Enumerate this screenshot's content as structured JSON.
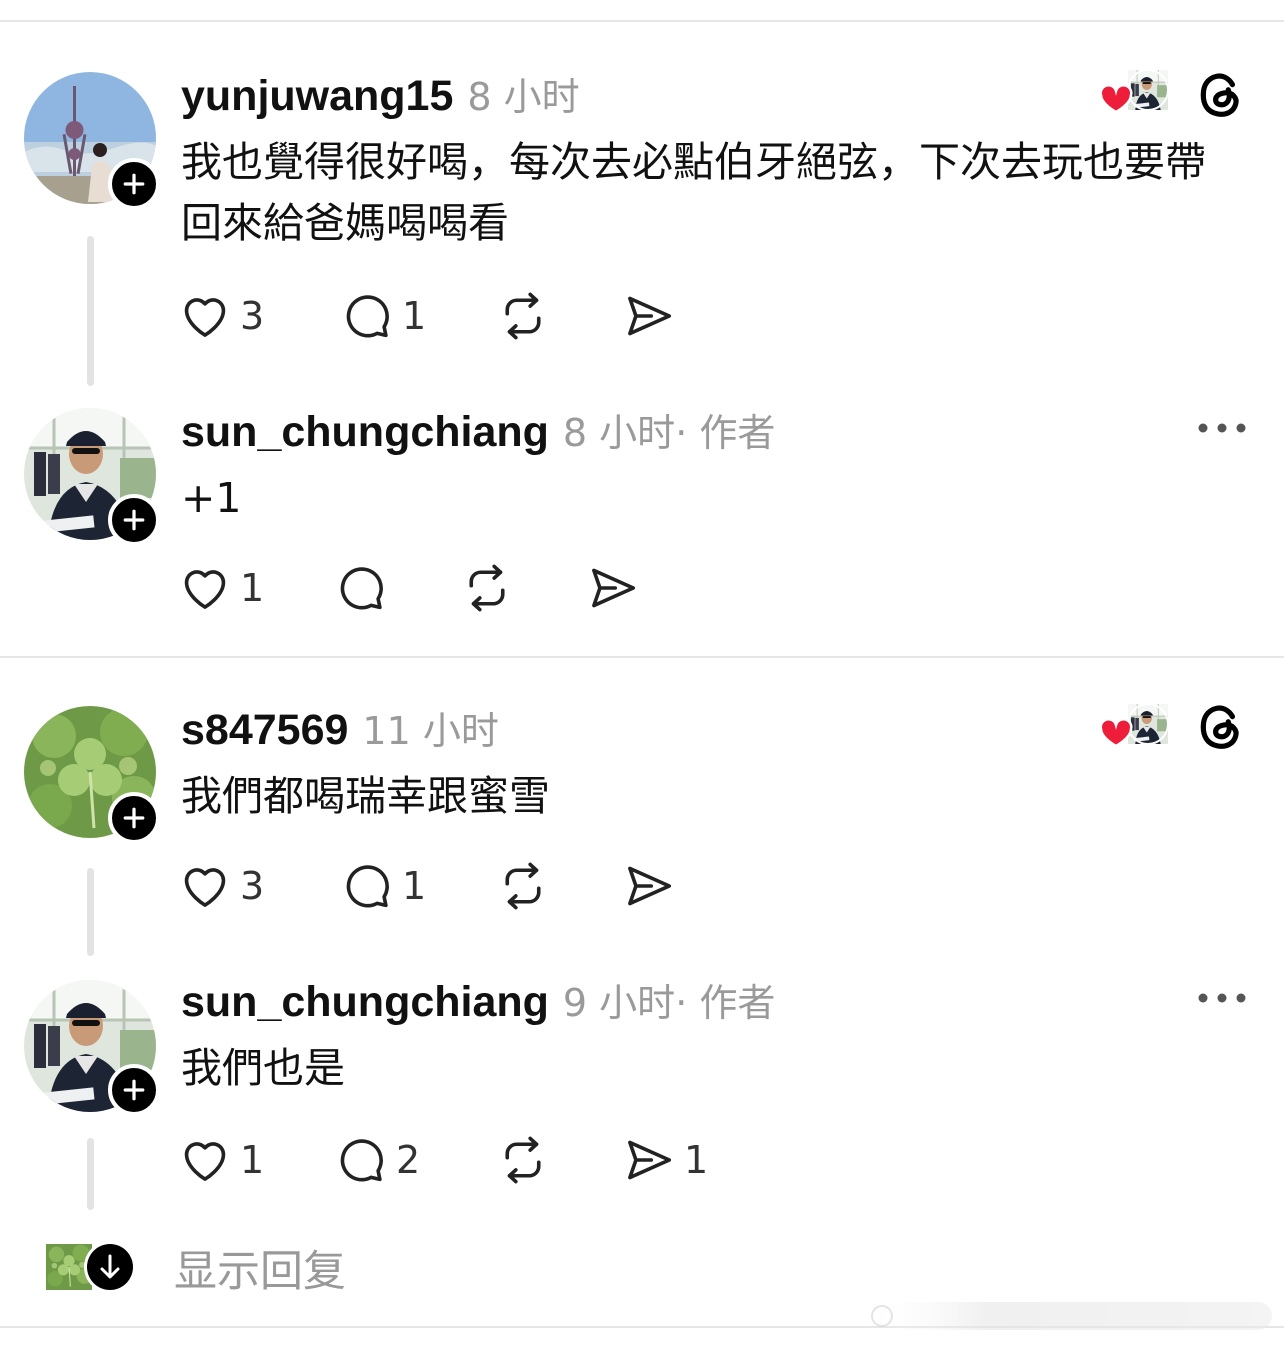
{
  "comments": [
    {
      "username": "yunjuwang15",
      "time": "8 小时",
      "author_tag": "",
      "text": "我也覺得很好喝，每次去必點伯牙絕弦，下次去玩也要帶回來給爸媽喝喝看",
      "likes": "3",
      "replies": "1",
      "reposts": "",
      "shares": ""
    },
    {
      "username": "sun_chungchiang",
      "time": "8 小时",
      "author_tag": " · 作者",
      "text": "+1",
      "likes": "1",
      "replies": "",
      "reposts": "",
      "shares": ""
    },
    {
      "username": "s847569",
      "time": "11 小时",
      "author_tag": "",
      "text": "我們都喝瑞幸跟蜜雪",
      "likes": "3",
      "replies": "1",
      "reposts": "",
      "shares": ""
    },
    {
      "username": "sun_chungchiang",
      "time": "9 小时",
      "author_tag": " · 作者",
      "text": "我們也是",
      "likes": "1",
      "replies": "2",
      "reposts": "",
      "shares": "1"
    }
  ],
  "show_replies_label": "显示回复",
  "colors": {
    "heart": "#ee1d3a",
    "muted": "#9a9a9a",
    "text": "#111111",
    "divider": "#e6e6e6"
  },
  "icons": [
    "heart-icon",
    "comment-icon",
    "repost-icon",
    "share-icon",
    "threads-icon",
    "more-icon",
    "plus-icon",
    "chevron-down-icon"
  ]
}
